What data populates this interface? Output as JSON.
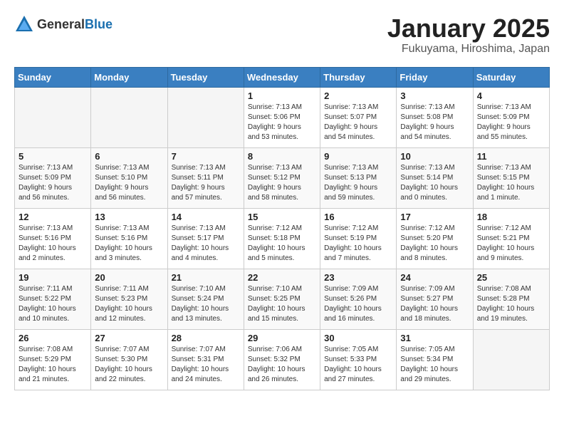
{
  "header": {
    "logo_general": "General",
    "logo_blue": "Blue",
    "month": "January 2025",
    "location": "Fukuyama, Hiroshima, Japan"
  },
  "weekdays": [
    "Sunday",
    "Monday",
    "Tuesday",
    "Wednesday",
    "Thursday",
    "Friday",
    "Saturday"
  ],
  "weeks": [
    [
      {
        "day": "",
        "content": ""
      },
      {
        "day": "",
        "content": ""
      },
      {
        "day": "",
        "content": ""
      },
      {
        "day": "1",
        "content": "Sunrise: 7:13 AM\nSunset: 5:06 PM\nDaylight: 9 hours\nand 53 minutes."
      },
      {
        "day": "2",
        "content": "Sunrise: 7:13 AM\nSunset: 5:07 PM\nDaylight: 9 hours\nand 54 minutes."
      },
      {
        "day": "3",
        "content": "Sunrise: 7:13 AM\nSunset: 5:08 PM\nDaylight: 9 hours\nand 54 minutes."
      },
      {
        "day": "4",
        "content": "Sunrise: 7:13 AM\nSunset: 5:09 PM\nDaylight: 9 hours\nand 55 minutes."
      }
    ],
    [
      {
        "day": "5",
        "content": "Sunrise: 7:13 AM\nSunset: 5:09 PM\nDaylight: 9 hours\nand 56 minutes."
      },
      {
        "day": "6",
        "content": "Sunrise: 7:13 AM\nSunset: 5:10 PM\nDaylight: 9 hours\nand 56 minutes."
      },
      {
        "day": "7",
        "content": "Sunrise: 7:13 AM\nSunset: 5:11 PM\nDaylight: 9 hours\nand 57 minutes."
      },
      {
        "day": "8",
        "content": "Sunrise: 7:13 AM\nSunset: 5:12 PM\nDaylight: 9 hours\nand 58 minutes."
      },
      {
        "day": "9",
        "content": "Sunrise: 7:13 AM\nSunset: 5:13 PM\nDaylight: 9 hours\nand 59 minutes."
      },
      {
        "day": "10",
        "content": "Sunrise: 7:13 AM\nSunset: 5:14 PM\nDaylight: 10 hours\nand 0 minutes."
      },
      {
        "day": "11",
        "content": "Sunrise: 7:13 AM\nSunset: 5:15 PM\nDaylight: 10 hours\nand 1 minute."
      }
    ],
    [
      {
        "day": "12",
        "content": "Sunrise: 7:13 AM\nSunset: 5:16 PM\nDaylight: 10 hours\nand 2 minutes."
      },
      {
        "day": "13",
        "content": "Sunrise: 7:13 AM\nSunset: 5:16 PM\nDaylight: 10 hours\nand 3 minutes."
      },
      {
        "day": "14",
        "content": "Sunrise: 7:13 AM\nSunset: 5:17 PM\nDaylight: 10 hours\nand 4 minutes."
      },
      {
        "day": "15",
        "content": "Sunrise: 7:12 AM\nSunset: 5:18 PM\nDaylight: 10 hours\nand 5 minutes."
      },
      {
        "day": "16",
        "content": "Sunrise: 7:12 AM\nSunset: 5:19 PM\nDaylight: 10 hours\nand 7 minutes."
      },
      {
        "day": "17",
        "content": "Sunrise: 7:12 AM\nSunset: 5:20 PM\nDaylight: 10 hours\nand 8 minutes."
      },
      {
        "day": "18",
        "content": "Sunrise: 7:12 AM\nSunset: 5:21 PM\nDaylight: 10 hours\nand 9 minutes."
      }
    ],
    [
      {
        "day": "19",
        "content": "Sunrise: 7:11 AM\nSunset: 5:22 PM\nDaylight: 10 hours\nand 10 minutes."
      },
      {
        "day": "20",
        "content": "Sunrise: 7:11 AM\nSunset: 5:23 PM\nDaylight: 10 hours\nand 12 minutes."
      },
      {
        "day": "21",
        "content": "Sunrise: 7:10 AM\nSunset: 5:24 PM\nDaylight: 10 hours\nand 13 minutes."
      },
      {
        "day": "22",
        "content": "Sunrise: 7:10 AM\nSunset: 5:25 PM\nDaylight: 10 hours\nand 15 minutes."
      },
      {
        "day": "23",
        "content": "Sunrise: 7:09 AM\nSunset: 5:26 PM\nDaylight: 10 hours\nand 16 minutes."
      },
      {
        "day": "24",
        "content": "Sunrise: 7:09 AM\nSunset: 5:27 PM\nDaylight: 10 hours\nand 18 minutes."
      },
      {
        "day": "25",
        "content": "Sunrise: 7:08 AM\nSunset: 5:28 PM\nDaylight: 10 hours\nand 19 minutes."
      }
    ],
    [
      {
        "day": "26",
        "content": "Sunrise: 7:08 AM\nSunset: 5:29 PM\nDaylight: 10 hours\nand 21 minutes."
      },
      {
        "day": "27",
        "content": "Sunrise: 7:07 AM\nSunset: 5:30 PM\nDaylight: 10 hours\nand 22 minutes."
      },
      {
        "day": "28",
        "content": "Sunrise: 7:07 AM\nSunset: 5:31 PM\nDaylight: 10 hours\nand 24 minutes."
      },
      {
        "day": "29",
        "content": "Sunrise: 7:06 AM\nSunset: 5:32 PM\nDaylight: 10 hours\nand 26 minutes."
      },
      {
        "day": "30",
        "content": "Sunrise: 7:05 AM\nSunset: 5:33 PM\nDaylight: 10 hours\nand 27 minutes."
      },
      {
        "day": "31",
        "content": "Sunrise: 7:05 AM\nSunset: 5:34 PM\nDaylight: 10 hours\nand 29 minutes."
      },
      {
        "day": "",
        "content": ""
      }
    ]
  ]
}
